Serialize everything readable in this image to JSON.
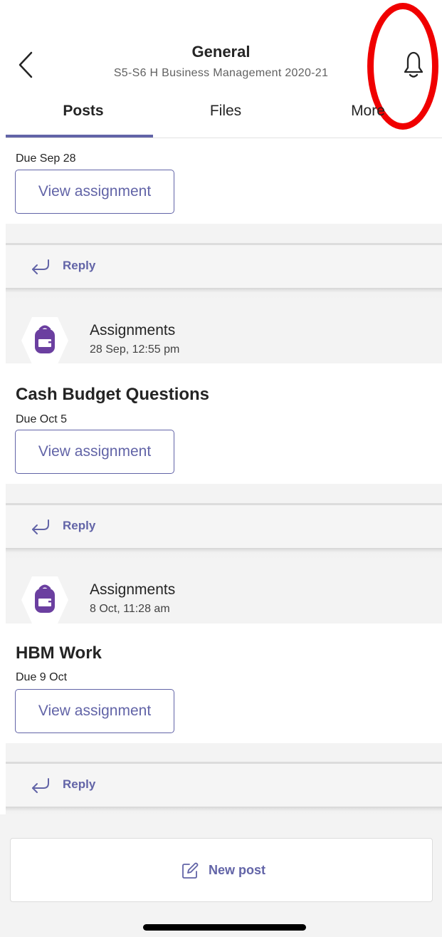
{
  "header": {
    "title": "General",
    "subtitle": "S5-S6 H Business Management 2020-21",
    "icons": {
      "back": "chevron-left-icon",
      "bell": "bell-icon"
    }
  },
  "tabs": [
    {
      "label": "Posts",
      "selected": true
    },
    {
      "label": "Files",
      "selected": false
    },
    {
      "label": "More",
      "selected": false
    }
  ],
  "feed": {
    "first_post": {
      "due": "Due Sep 28",
      "button": "View assignment",
      "reply": "Reply"
    },
    "posts": [
      {
        "sender": "Assignments",
        "timestamp": "28 Sep, 12:55 pm",
        "title": "Cash Budget Questions",
        "due": "Due Oct 5",
        "button": "View assignment",
        "reply": "Reply"
      },
      {
        "sender": "Assignments",
        "timestamp": "8 Oct, 11:28 am",
        "title": "HBM Work",
        "due": "Due 9 Oct",
        "button": "View assignment",
        "reply": "Reply"
      }
    ]
  },
  "compose": {
    "label": "New post",
    "icon": "compose-icon"
  },
  "colors": {
    "accent": "#6264a7",
    "annotation": "#f00000",
    "app_icon": "#6b3fa0"
  }
}
